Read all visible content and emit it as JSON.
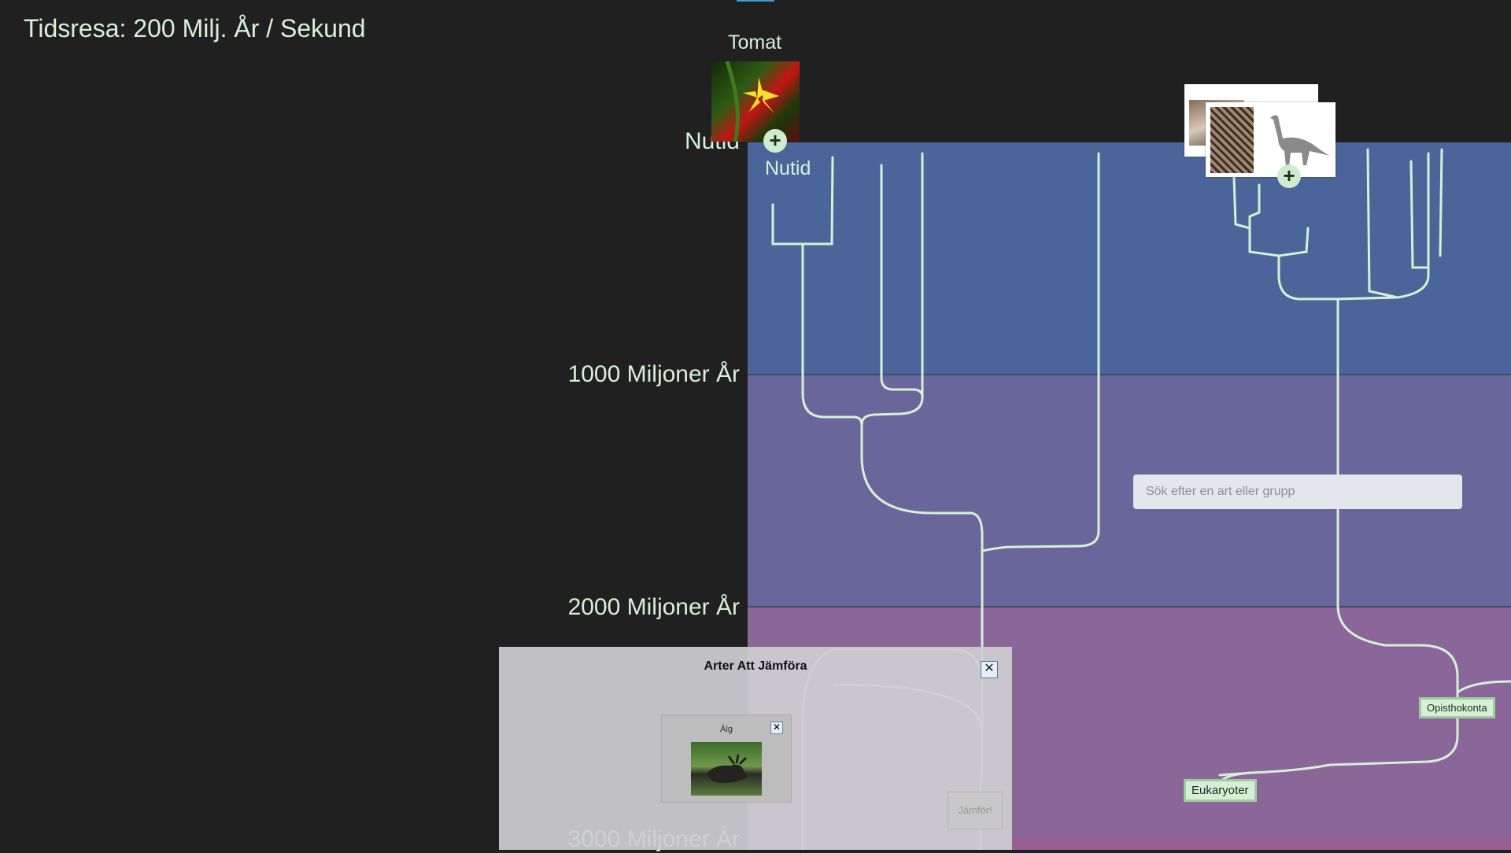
{
  "title": "Tidsresa: 200 Milj. År / Sekund",
  "timeline": {
    "labels": [
      "Nutid",
      "1000 Miljoner År",
      "2000 Miljoner År",
      "3000 Miljoner År"
    ],
    "inner_now_label": "Nutid",
    "band_colors": [
      "#4b659a",
      "#68669a",
      "#8a6699",
      "#9a5f94"
    ]
  },
  "species": {
    "featured_name": "Tomat",
    "add_icon": "plus-icon",
    "add_symbol": "+"
  },
  "tree_nodes": {
    "eukaryotes": "Eukaryoter",
    "opisthokonta": "Opisthokonta"
  },
  "search": {
    "placeholder": "Sök efter en art eller grupp",
    "value": ""
  },
  "compare_panel": {
    "title": "Arter Att Jämföra",
    "close_symbol": "✕",
    "items": [
      {
        "name": "Älg",
        "remove_symbol": "✕"
      }
    ],
    "compare_button_label": "Jämför!"
  },
  "colors": {
    "text_accent": "#d8f0d8",
    "branch": "#d6f0d6",
    "background": "#202020"
  }
}
